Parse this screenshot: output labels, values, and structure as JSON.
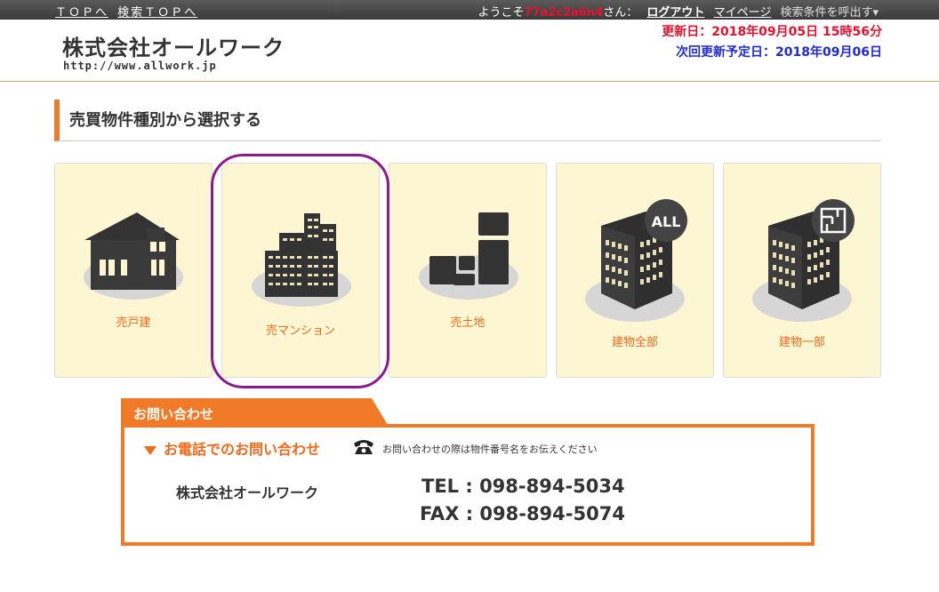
{
  "topbar": {
    "top_link": "ＴＯＰへ",
    "search_top_link": "検索ＴＯＰへ",
    "welcome_prefix": "ようこそ",
    "username": "77a2c2a6n4",
    "welcome_suffix": "さん：",
    "logout": "ログアウト",
    "mypage": "マイページ",
    "recall_search": "検索条件を呼出す▾"
  },
  "header": {
    "company_logo": "株式会社オールワーク",
    "url": "http://www.allwork.jp",
    "updated": "更新日：2018年09月05日 15時56分",
    "next_update": "次回更新予定日：2018年09月06日"
  },
  "section": {
    "title": "売買物件種別から選択する"
  },
  "categories": [
    {
      "label": "売戸建",
      "icon": "house-icon"
    },
    {
      "label": "売マンション",
      "icon": "apartment-icon"
    },
    {
      "label": "売土地",
      "icon": "land-icon"
    },
    {
      "label": "建物全部",
      "icon": "building-all-icon",
      "badge": "ALL"
    },
    {
      "label": "建物一部",
      "icon": "building-part-icon"
    }
  ],
  "contact": {
    "tab_title": "お問い合わせ",
    "phone_heading": "お電話でのお問い合わせ",
    "note": "お問い合わせの際は物件番号名をお伝えください",
    "company": "株式会社オールワーク",
    "tel": "TEL : 098-894-5034",
    "fax": "FAX : 098-894-5074"
  },
  "colors": {
    "accent": "#f07a28",
    "card_bg": "#fdf6d3",
    "updated": "#e8112d",
    "next_update": "#1f2ad6",
    "highlight": "#8a1b8e"
  }
}
